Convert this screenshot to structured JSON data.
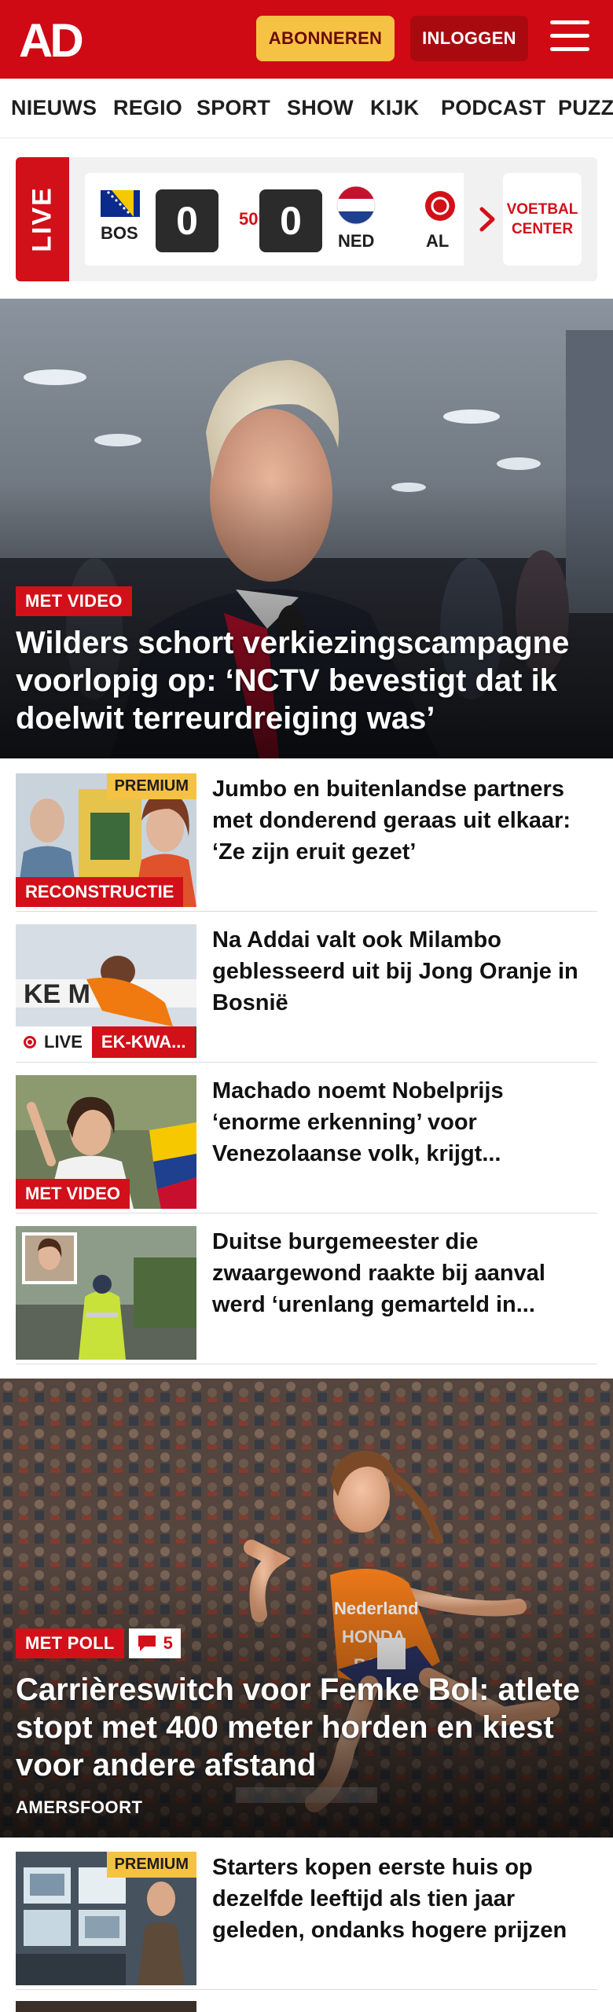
{
  "header": {
    "logo_text": "AD",
    "subscribe_label": "ABONNEREN",
    "login_label": "INLOGGEN",
    "brand_color": "#cf0a14"
  },
  "nav": {
    "items": [
      "NIEUWS",
      "REGIO",
      "SPORT",
      "SHOW",
      "KIJK",
      "PODCAST",
      "PUZZ"
    ]
  },
  "live": {
    "label": "LIVE",
    "match": {
      "home_code": "BOS",
      "home_score": "0",
      "minute": "50'",
      "away_score": "0",
      "away_code": "NED"
    },
    "next_match_code": "AL",
    "football_center_line1": "VOETBAL",
    "football_center_line2": "CENTER"
  },
  "hero1": {
    "badge": "MET VIDEO",
    "title": "Wilders schort verkiezingscampagne voorlopig op: ‘NCTV bevestigt dat ik doelwit terreurdreiging was’"
  },
  "articles": [
    {
      "title": "Jumbo en buitenlandse partners met donderend geraas uit elkaar: ‘Ze zijn eruit gezet’",
      "premium": "PREMIUM",
      "badge": "RECONSTRUCTIE"
    },
    {
      "title": "Na Addai valt ook Milambo geblesseerd uit bij Jong Oranje in Bosnië",
      "live": "LIVE",
      "badge": "EK-KWA..."
    },
    {
      "title": "Machado noemt Nobelprijs ‘enorme erkenning’ voor Venezolaanse volk, krijgt...",
      "badge": "MET VIDEO"
    },
    {
      "title": "Duitse burgemeester die zwaargewond raakte bij aanval werd ‘urenlang gemarteld in..."
    }
  ],
  "hero2": {
    "badge": "MET POLL",
    "comments": "5",
    "title": "Carrièreswitch voor Femke Bol: atlete stopt met 400 meter horden en kiest voor andere afstand",
    "location": "AMERSFOORT"
  },
  "article_after": {
    "title": "Starters kopen eerste huis op dezelfde leeftijd als tien jaar geleden, ondanks hogere prijzen",
    "premium": "PREMIUM"
  },
  "icons": {
    "menu": "hamburger-menu-icon",
    "arrow": "chevron-right-icon",
    "comment": "comment-bubble-icon",
    "live_dot": "live-dot-icon"
  }
}
